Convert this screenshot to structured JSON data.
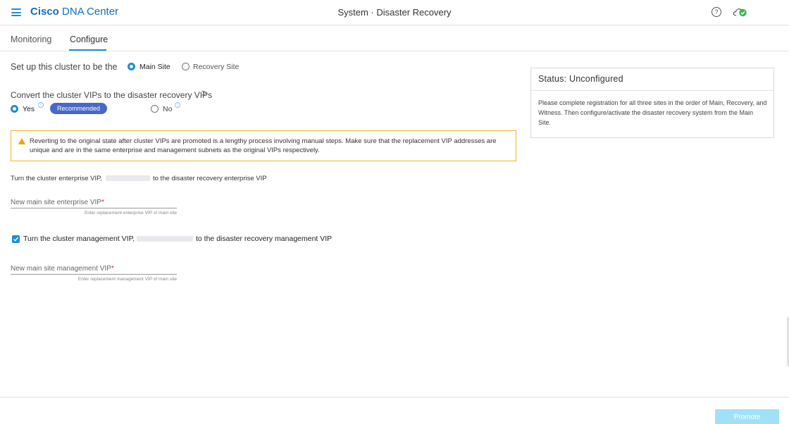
{
  "header": {
    "brand_bold": "Cisco",
    "brand_rest": " DNA Center",
    "title": "System · Disaster Recovery",
    "help_glyph": "?"
  },
  "tabs": [
    {
      "label": "Monitoring",
      "active": false
    },
    {
      "label": "Configure",
      "active": true
    }
  ],
  "setup": {
    "label": "Set up this cluster to be the",
    "options": [
      {
        "label": "Main Site",
        "selected": true
      },
      {
        "label": "Recovery Site",
        "selected": false
      }
    ]
  },
  "convert": {
    "label": "Convert the cluster VIPs to the disaster recovery VIPs",
    "chevron": ">",
    "yes_label": "Yes",
    "yes_selected": true,
    "badge": "Recommended",
    "no_label": "No",
    "no_selected": false,
    "info_glyph": "i"
  },
  "warning": {
    "text": "Reverting to the original state after cluster VIPs are promoted is a lengthy process involving manual steps. Make sure that the replacement VIP addresses are unique and are in the same enterprise and management subnets as the original VIPs respectively.",
    "color": "#f0b429"
  },
  "enterprise": {
    "prefix": "Turn the cluster enterprise VIP,",
    "suffix": "to the disaster recovery enterprise VIP",
    "field_label": "New main site enterprise VIP",
    "required_mark": "*",
    "helper": "Enter replacement enterprise VIP of main site"
  },
  "management": {
    "checked": true,
    "prefix": "Turn the cluster management VIP,",
    "suffix": "to the disaster recovery management VIP",
    "field_label": "New main site management VIP",
    "required_mark": "*",
    "helper": "Enter replacement management VIP of main site"
  },
  "status": {
    "title": "Status: Unconfigured",
    "body": "Please complete registration for all three sites in the order of Main, Recovery, and Witness. Then configure/activate the disaster recovery system from the Main Site."
  },
  "footer": {
    "promote_label": "Promote"
  },
  "colors": {
    "accent": "#1e8cd8",
    "brand": "#0d6fc6",
    "badge": "#4768c9",
    "warning": "#f0b429",
    "promote_disabled": "#9fe2f7",
    "status_ok": "#3bb54a"
  }
}
